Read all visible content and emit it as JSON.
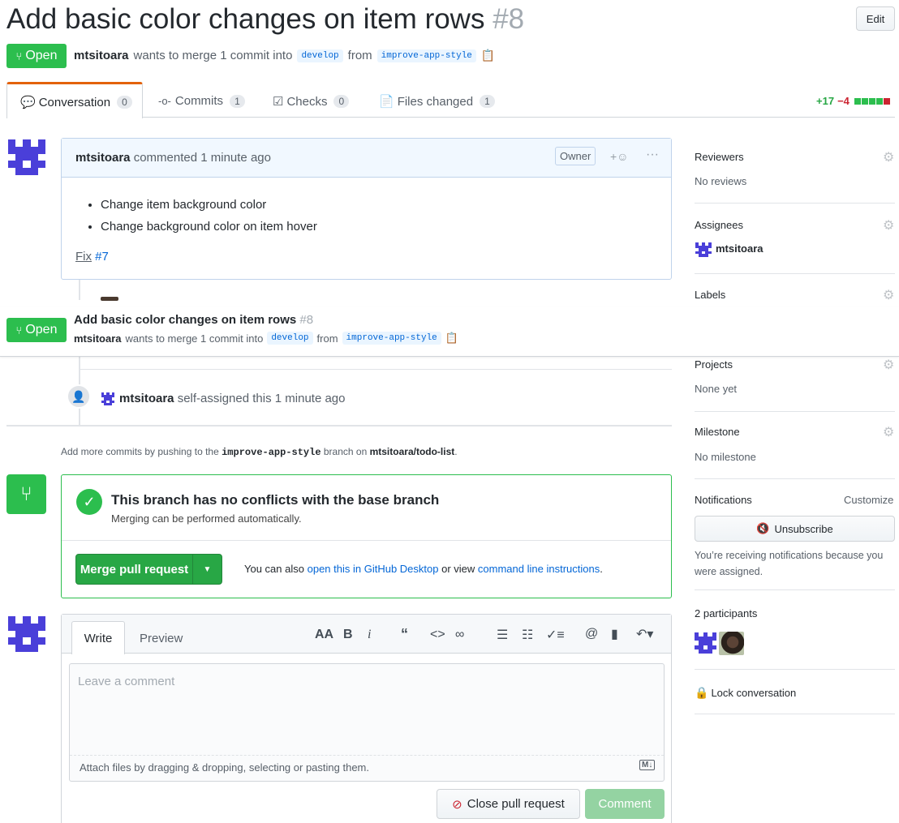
{
  "header": {
    "title": "Add basic color changes on item rows",
    "number": "#8",
    "edit_label": "Edit",
    "state_label": "Open",
    "author": "mtsitoara",
    "merge_text": "wants to merge 1 commit into",
    "base_branch": "develop",
    "from_text": "from",
    "head_branch": "improve-app-style"
  },
  "tabs": [
    {
      "label": "Conversation",
      "count": "0"
    },
    {
      "label": "Commits",
      "count": "1"
    },
    {
      "label": "Checks",
      "count": "0"
    },
    {
      "label": "Files changed",
      "count": "1"
    }
  ],
  "diffstat": {
    "additions": "+17",
    "deletions": "−4"
  },
  "comment": {
    "author": "mtsitoara",
    "meta": "commented 1 minute ago",
    "role": "Owner",
    "bullets": [
      "Change item background color",
      "Change background color on item hover"
    ],
    "fix_text": "Fix",
    "fix_ref": "#7"
  },
  "sticky": {
    "state_label": "Open",
    "title": "Add basic color changes on item rows",
    "number": "#8",
    "author": "mtsitoara",
    "merge_text": "wants to merge 1 commit into",
    "base_branch": "develop",
    "from_text": "from",
    "head_branch": "improve-app-style"
  },
  "event": {
    "author": "mtsitoara",
    "text": "self-assigned this 1 minute ago"
  },
  "push_hint": {
    "prefix": "Add more commits by pushing to the",
    "branch": "improve-app-style",
    "middle": "branch on",
    "repo": "mtsitoara/todo-list",
    "suffix": "."
  },
  "merge_box": {
    "title": "This branch has no conflicts with the base branch",
    "subtitle": "Merging can be performed automatically.",
    "merge_button": "Merge pull request",
    "also_text": "You can also",
    "desktop_link": "open this in GitHub Desktop",
    "or_view": "or view",
    "cli_link": "command line instructions",
    "period": "."
  },
  "editor": {
    "tab_write": "Write",
    "tab_preview": "Preview",
    "placeholder": "Leave a comment",
    "attach_hint": "Attach files by dragging & dropping, selecting or pasting them.",
    "close_button": "Close pull request",
    "comment_button": "Comment"
  },
  "sidebar": {
    "reviewers": {
      "title": "Reviewers",
      "value": "No reviews"
    },
    "assignees": {
      "title": "Assignees",
      "value": "mtsitoara"
    },
    "labels": {
      "title": "Labels"
    },
    "projects": {
      "title": "Projects",
      "value": "None yet"
    },
    "milestone": {
      "title": "Milestone",
      "value": "No milestone"
    },
    "notifications": {
      "title": "Notifications",
      "customize": "Customize",
      "unsubscribe": "Unsubscribe",
      "reason": "You’re receiving notifications because you were assigned."
    },
    "participants": {
      "title": "2 participants"
    },
    "lock": "Lock conversation"
  },
  "colors": {
    "green": "#2cbe4e",
    "blue_link": "#0366d6",
    "identicon": "#4a3fd9"
  }
}
